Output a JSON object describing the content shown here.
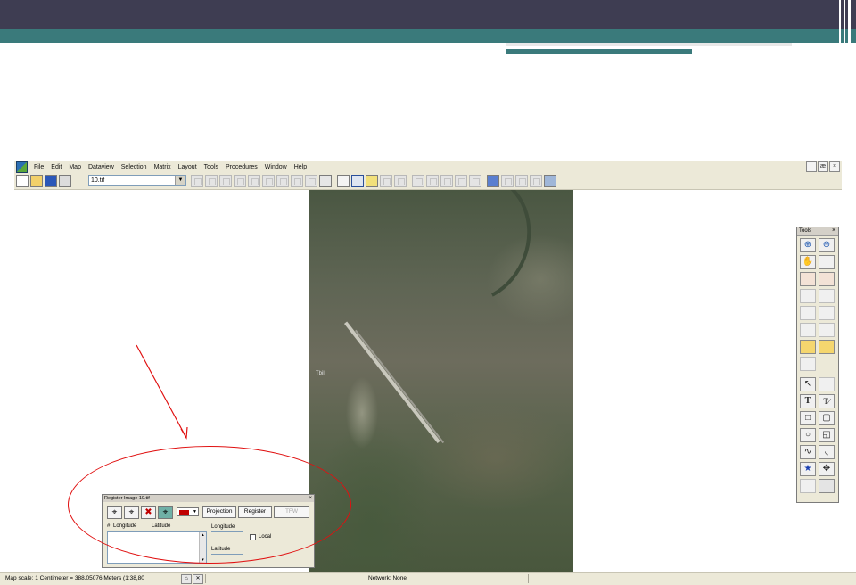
{
  "app": {
    "menu": [
      "File",
      "Edit",
      "Map",
      "Dataview",
      "Selection",
      "Matrix",
      "Layout",
      "Tools",
      "Procedures",
      "Window",
      "Help"
    ],
    "window_controls": [
      "_",
      "æ",
      "×"
    ]
  },
  "toolbar": {
    "layer_combo_value": "10.tif",
    "combo_arrow": "▼"
  },
  "satellite": {
    "label": "Tbil"
  },
  "tools_panel": {
    "title": "Tools",
    "close": "×",
    "glyphs": {
      "zoom_in": "⊕",
      "zoom_out": "⊖",
      "pan": "✋",
      "select": "↖",
      "text": "T",
      "text_italic": "T∕",
      "rect": "□",
      "rounded_rect": "▢",
      "ellipse": "○",
      "polygon": "◱",
      "freehand": "∿",
      "arc": "◟",
      "star": "★",
      "move": "✥"
    }
  },
  "register_dialog": {
    "title": "Register Image 10.tif",
    "close": "×",
    "buttons": {
      "projection": "Projection",
      "register": "Register",
      "tfw": "TFW"
    },
    "crosshair_glyph": "⌖",
    "delete_glyph": "✖",
    "color_arrow": "▼",
    "columns": {
      "hash": "#",
      "longitude": "Longitude",
      "latitude": "Latitude"
    },
    "fields": {
      "longitude_label": "Longitude",
      "latitude_label": "Latitude",
      "local_label": "Local"
    },
    "scroll_up": "▴",
    "scroll_down": "▾"
  },
  "statusbar": {
    "scale_text": "Map scale: 1 Centimeter = 388.05076 Meters (1:38,80",
    "network_text": "Network: None",
    "btn1": "⌂",
    "btn2": "✕"
  },
  "colors": {
    "slide_top": "#3e3d52",
    "slide_teal": "#3a7a7b",
    "annotation_red": "#e01010",
    "app_chrome": "#ece9d8"
  }
}
